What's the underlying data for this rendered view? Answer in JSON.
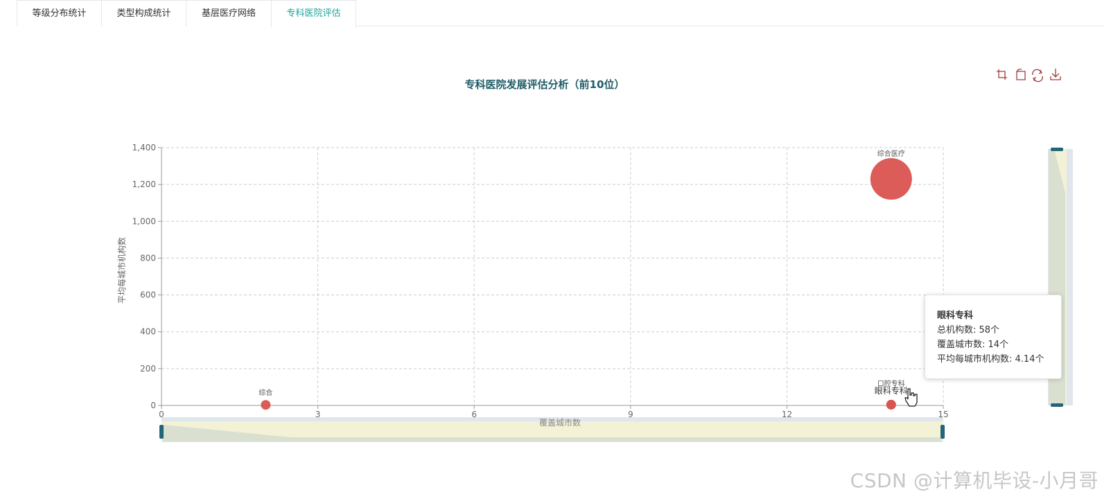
{
  "tabs": [
    {
      "label": "等级分布统计",
      "active": false
    },
    {
      "label": "类型构成统计",
      "active": false
    },
    {
      "label": "基层医疗网络",
      "active": false
    },
    {
      "label": "专科医院评估",
      "active": true
    }
  ],
  "colors": {
    "accent": "#1aa39a",
    "title": "#1e5b66",
    "bubble": "#d9534f",
    "toolbox": "#a23a3a",
    "slider_handle": "#226478"
  },
  "toolbox": {
    "icons": [
      "zoom-icon",
      "zoom-reset-icon",
      "refresh-icon",
      "download-icon"
    ]
  },
  "chart_data": {
    "type": "scatter",
    "title": "专科医院发展评估分析（前10位）",
    "xlabel": "覆盖城市数",
    "ylabel": "平均每城市机构数",
    "xlim": [
      0,
      15
    ],
    "ylim": [
      0,
      1400
    ],
    "x_ticks": [
      0,
      3,
      6,
      9,
      12,
      15
    ],
    "y_ticks": [
      0,
      200,
      400,
      600,
      800,
      1000,
      1200,
      1400
    ],
    "y_tick_labels": [
      "0",
      "200",
      "400",
      "600",
      "800",
      "1,000",
      "1,200",
      "1,400"
    ],
    "grid": true,
    "points": [
      {
        "name": "综合医疗",
        "x": 14,
        "y": 1230,
        "size_level": "large"
      },
      {
        "name": "综合",
        "x": 2,
        "y": 3,
        "size_level": "small"
      },
      {
        "name": "口腔专科",
        "x": 14,
        "y": 4,
        "size_level": "small"
      },
      {
        "name": "眼科专科",
        "x": 14,
        "y": 4.14,
        "size_level": "small"
      }
    ]
  },
  "tooltip": {
    "title": "眼科专科",
    "line1": "总机构数: 58个",
    "line2": "覆盖城市数: 14个",
    "line3": "平均每城市机构数: 4.14个"
  },
  "watermark": "CSDN @计算机毕设-小月哥"
}
